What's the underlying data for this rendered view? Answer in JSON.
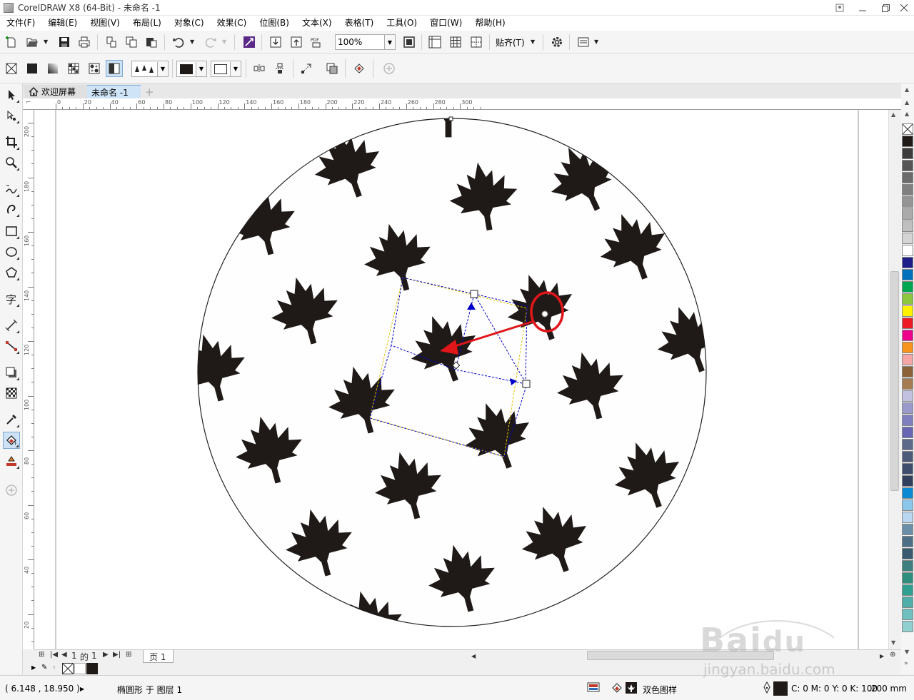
{
  "window": {
    "title": "CorelDRAW X8 (64-Bit) - 未命名 -1"
  },
  "menu": [
    "文件(F)",
    "编辑(E)",
    "视图(V)",
    "布局(L)",
    "对象(C)",
    "效果(C)",
    "位图(B)",
    "文本(X)",
    "表格(T)",
    "工具(O)",
    "窗口(W)",
    "帮助(H)"
  ],
  "toolbar": {
    "zoom_value": "100%",
    "snap_label": "贴齐(T)"
  },
  "tabs": {
    "welcome": "欢迎屏幕",
    "document": "未命名 -1"
  },
  "rulers": {
    "horizontal": [
      "0",
      "20",
      "40",
      "60",
      "80",
      "100",
      "120",
      "140",
      "160",
      "180",
      "200",
      "220",
      "240",
      "260",
      "280",
      "300"
    ],
    "vertical": [
      "200",
      "180",
      "160",
      "140",
      "120",
      "100",
      "80",
      "60",
      "40",
      "20"
    ]
  },
  "page_nav": {
    "current": "1",
    "of": "的",
    "total": "1",
    "page_tab": "页 1"
  },
  "status": {
    "coords": "( 6.148 , 18.950 )",
    "object_info": "椭圆形 于 图层 1",
    "fill_type": "双色图样",
    "outline_color": "C: 0 M: 0 Y: 0 K: 100",
    "outline_width": ".200 mm"
  },
  "colors": {
    "leaf": "#1f1a17",
    "selection": "#0000cc",
    "annotation": "#e0161b",
    "accent": "#7fb1df"
  },
  "palette": [
    "#ffffff",
    "#1f1a17",
    "#3d3d3d",
    "#555555",
    "#6b6b6b",
    "#808080",
    "#959595",
    "#aaaaaa",
    "#bfbfbf",
    "#d4d4d4",
    "#ffffff",
    "#1d1d8a",
    "#0072bc",
    "#00a651",
    "#8dc63f",
    "#fff200",
    "#ed1c24",
    "#ec008c",
    "#f7941d",
    "#f4a6a6",
    "#8c6239",
    "#a67c52",
    "#c2c2e0",
    "#9999cc",
    "#7f7fbf",
    "#6666b2",
    "#5c6b8a",
    "#4d5b7a",
    "#3e4d6b",
    "#2f3f5c",
    "#0a8ad2",
    "#8ac7eb",
    "#b8d6ef",
    "#6b8fa8",
    "#4f6f86",
    "#3a5a6e",
    "#3f7f7f",
    "#2f8f7f",
    "#2f9f8f",
    "#4fafa8",
    "#6fbfbf",
    "#8fcfcf"
  ]
}
